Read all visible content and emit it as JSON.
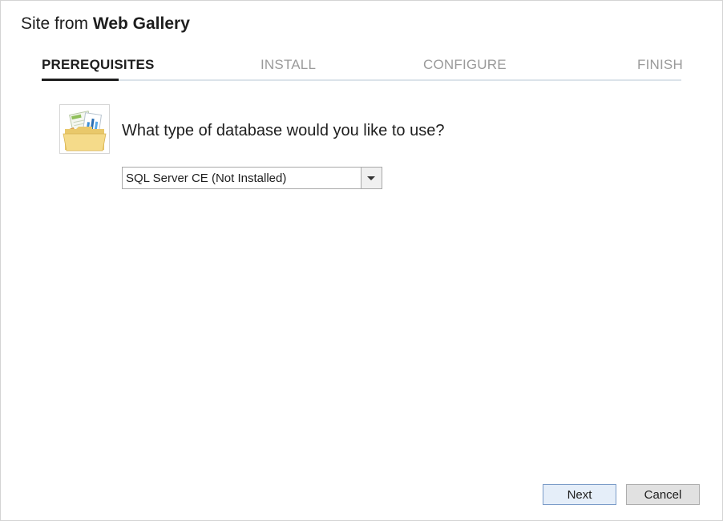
{
  "dialog": {
    "title_prefix": "Site from",
    "title_bold": "Web Gallery"
  },
  "steps": [
    {
      "label": "PREREQUISITES",
      "active": true
    },
    {
      "label": "INSTALL",
      "active": false
    },
    {
      "label": "CONFIGURE",
      "active": false
    },
    {
      "label": "FINISH",
      "active": false
    }
  ],
  "content": {
    "icon": "database-folder-icon",
    "question": "What type of database would you like to use?",
    "database_select": {
      "selected": "SQL Server CE (Not Installed)"
    }
  },
  "buttons": {
    "next": "Next",
    "cancel": "Cancel"
  },
  "colors": {
    "step_active": "#1e1e1e",
    "step_inactive": "#9a9a9a",
    "step_rule": "#dbe3ea",
    "next_border": "#7a9bc8"
  }
}
